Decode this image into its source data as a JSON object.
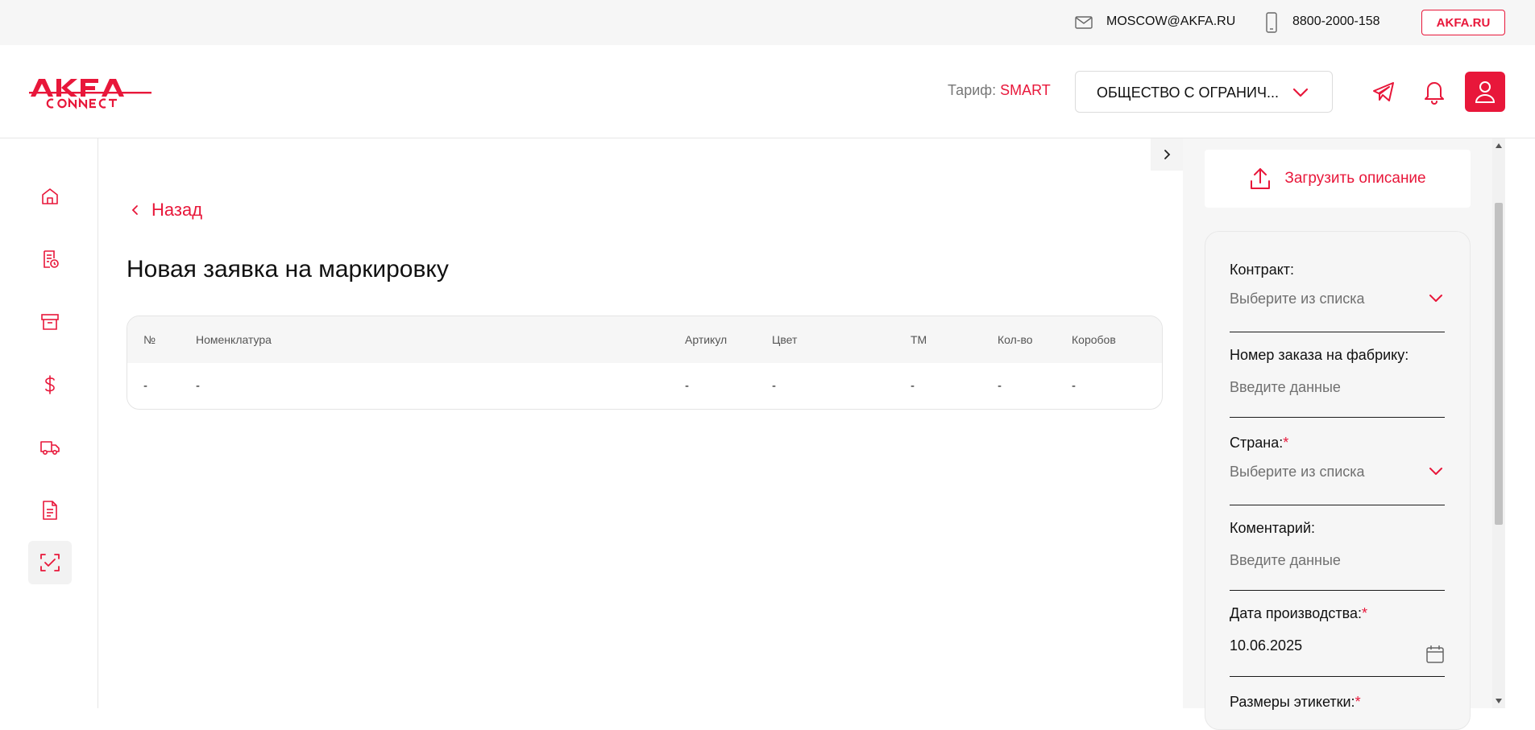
{
  "colors": {
    "accent": "#e8173a",
    "topbar_bg": "#f6f6f6",
    "panel_bg": "#f6f6f6"
  },
  "topbar": {
    "email": "MOSCOW@AKFA.RU",
    "phone": "8800-2000-158",
    "site_label": "AKFA.RU"
  },
  "header": {
    "logo_icon": "akfa-connect-logo",
    "tariff_label": "Тариф:",
    "tariff_value": "SMART",
    "org_select_value": "ОБЩЕСТВО С ОГРАНИЧ...",
    "icons": [
      "telegram-icon",
      "bell-icon",
      "user-icon"
    ]
  },
  "sidebar": {
    "items": [
      {
        "icon": "home-icon"
      },
      {
        "icon": "document-clock-icon"
      },
      {
        "icon": "archive-box-icon"
      },
      {
        "icon": "dollar-icon"
      },
      {
        "icon": "truck-icon"
      },
      {
        "icon": "document-text-icon"
      },
      {
        "icon": "scan-check-icon",
        "active": true
      }
    ]
  },
  "main": {
    "back_label": "Назад",
    "title": "Новая заявка на маркировку",
    "table": {
      "columns": [
        "№",
        "Номенклатура",
        "Артикул",
        "Цвет",
        "ТМ",
        "Кол-во",
        "Коробов"
      ],
      "rows": [
        [
          "-",
          "-",
          "-",
          "-",
          "-",
          "-",
          "-"
        ]
      ]
    }
  },
  "panel": {
    "upload_label": "Загрузить описание",
    "fields": [
      {
        "label": "Контракт:",
        "value": "Выберите из списка",
        "required": false,
        "kind": "select"
      },
      {
        "label": "Номер заказа на фабрику:",
        "value": "Введите данные",
        "required": false,
        "kind": "input"
      },
      {
        "label": "Страна:",
        "value": "Выберите из списка",
        "required": true,
        "kind": "select"
      },
      {
        "label": "Коментарий:",
        "value": "Введите данные",
        "required": false,
        "kind": "input"
      },
      {
        "label": "Дата производства:",
        "value": "10.06.2025",
        "required": true,
        "kind": "date"
      },
      {
        "label": "Размеры этикетки:",
        "required": true
      }
    ],
    "required_mark": "*"
  }
}
